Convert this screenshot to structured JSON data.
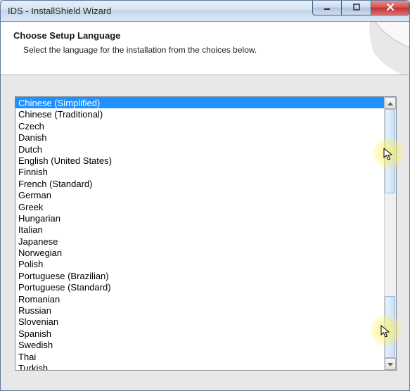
{
  "window": {
    "title": "IDS - InstallShield Wizard"
  },
  "header": {
    "title": "Choose Setup Language",
    "subtitle": "Select the language for the installation from the choices below."
  },
  "languages": [
    {
      "label": "Chinese (Simplified)",
      "selected": true
    },
    {
      "label": "Chinese (Traditional)",
      "selected": false
    },
    {
      "label": "Czech",
      "selected": false
    },
    {
      "label": "Danish",
      "selected": false
    },
    {
      "label": "Dutch",
      "selected": false
    },
    {
      "label": "English (United States)",
      "selected": false
    },
    {
      "label": "Finnish",
      "selected": false
    },
    {
      "label": "French (Standard)",
      "selected": false
    },
    {
      "label": "German",
      "selected": false
    },
    {
      "label": "Greek",
      "selected": false
    },
    {
      "label": "Hungarian",
      "selected": false
    },
    {
      "label": "Italian",
      "selected": false
    },
    {
      "label": "Japanese",
      "selected": false
    },
    {
      "label": "Norwegian",
      "selected": false
    },
    {
      "label": "Polish",
      "selected": false
    },
    {
      "label": "Portuguese (Brazilian)",
      "selected": false
    },
    {
      "label": "Portuguese (Standard)",
      "selected": false
    },
    {
      "label": "Romanian",
      "selected": false
    },
    {
      "label": "Russian",
      "selected": false
    },
    {
      "label": "Slovenian",
      "selected": false
    },
    {
      "label": "Spanish",
      "selected": false
    },
    {
      "label": "Swedish",
      "selected": false
    },
    {
      "label": "Thai",
      "selected": false
    },
    {
      "label": "Turkish",
      "selected": false
    }
  ]
}
